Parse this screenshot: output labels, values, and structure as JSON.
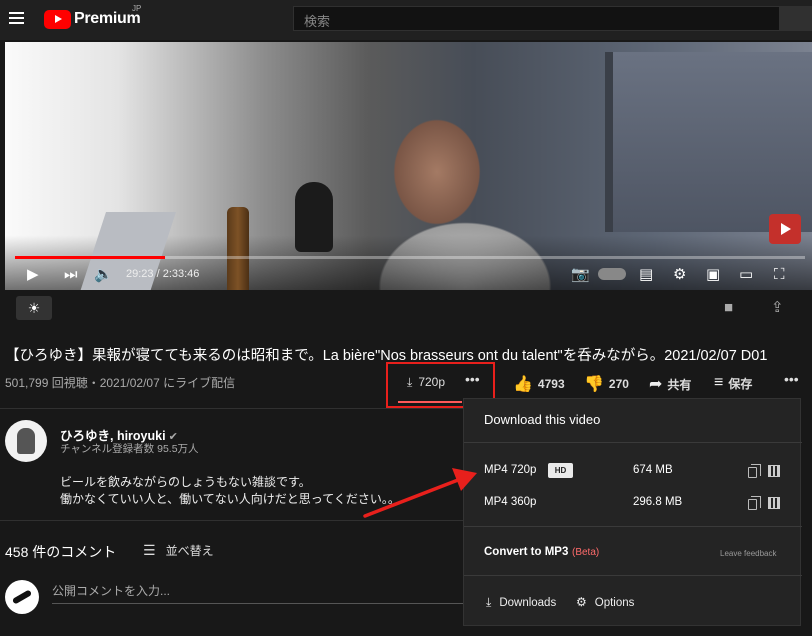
{
  "header": {
    "logo_text": "Premium",
    "logo_sup": "JP",
    "search_placeholder": "検索"
  },
  "player": {
    "time": "29:23 / 2:33:46",
    "progress_fraction": 0.19
  },
  "video": {
    "title": "【ひろゆき】果報が寝てても来るのは昭和まで。La bière\"Nos brasseurs ont du talent\"を呑みながら。2021/02/07 D01",
    "meta": "501,799 回視聴・2021/02/07 にライブ配信",
    "download_label": "720p",
    "likes": "4793",
    "dislikes": "270",
    "share_label": "共有",
    "save_label": "保存"
  },
  "channel": {
    "name": "ひろゆき, hiroyuki",
    "subs": "チャンネル登録者数 95.5万人",
    "desc_line1": "ビールを飲みながらのしょうもない雑談です。",
    "desc_line2": "働かなくていい人と、働いてない人向けだと思ってください。。"
  },
  "comments": {
    "count_label": "458 件のコメント",
    "sort_label": "並べ替え",
    "placeholder": "公開コメントを入力..."
  },
  "download_popup": {
    "title": "Download this video",
    "rows": [
      {
        "label": "MP4 720p",
        "badge": "HD",
        "size": "674 MB"
      },
      {
        "label": "MP4 360p",
        "badge": "",
        "size": "296.8 MB"
      }
    ],
    "mp3_label": "Convert to MP3",
    "beta_label": "(Beta)",
    "feedback_label": "Leave feedback",
    "downloads_label": "Downloads",
    "options_label": "Options"
  },
  "colors": {
    "accent": "#ff0000",
    "highlight_box": "#e8201c",
    "arrow": "#e8201c"
  }
}
